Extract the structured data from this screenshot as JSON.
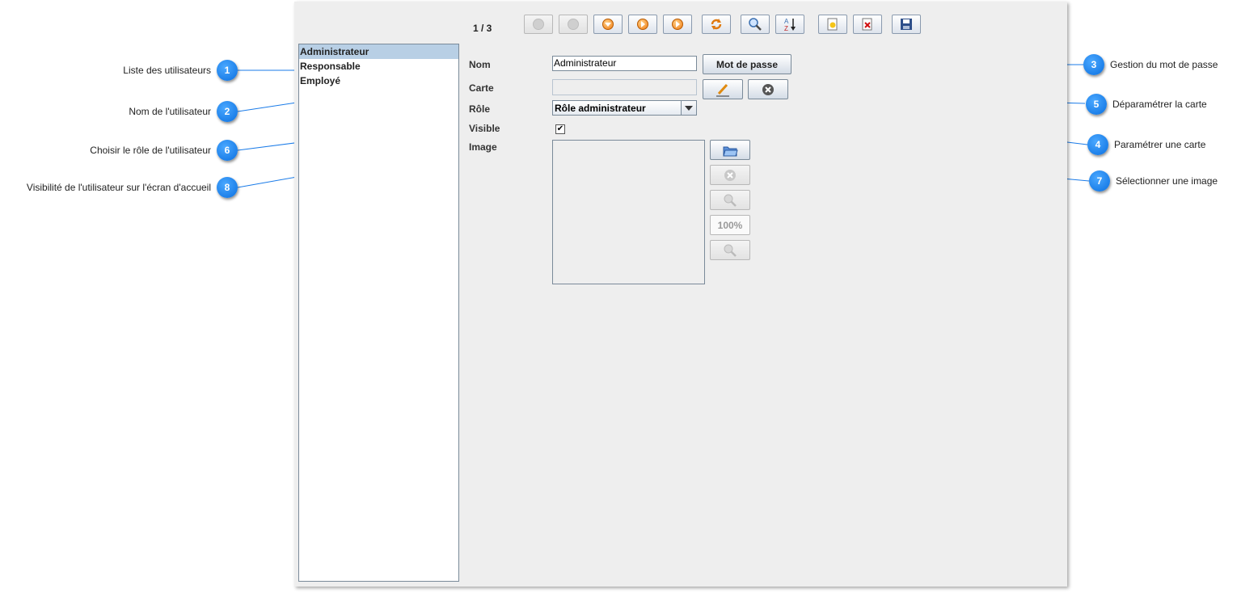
{
  "toolbar": {
    "counter": "1 / 3",
    "zoom_label": "100%"
  },
  "users": [
    "Administrateur",
    "Responsable",
    "Employé"
  ],
  "form": {
    "nom_label": "Nom",
    "nom_value": "Administrateur",
    "carte_label": "Carte",
    "carte_value": "",
    "role_label": "Rôle",
    "role_value": "Rôle administrateur",
    "visible_label": "Visible",
    "image_label": "Image",
    "password_button": "Mot de passe"
  },
  "annotations": [
    {
      "num": "1",
      "text": "Liste des utilisateurs"
    },
    {
      "num": "2",
      "text": "Nom de l'utilisateur"
    },
    {
      "num": "3",
      "text": "Gestion du mot de passe"
    },
    {
      "num": "4",
      "text": "Paramétrer une carte"
    },
    {
      "num": "5",
      "text": "Déparamétrer la carte"
    },
    {
      "num": "6",
      "text": "Choisir le rôle de l'utilisateur"
    },
    {
      "num": "7",
      "text": "Sélectionner une image"
    },
    {
      "num": "8",
      "text": "Visibilité de l'utilisateur sur l'écran d'accueil"
    }
  ],
  "colors": {
    "accent": "#0a6fe0",
    "selection": "#b8cfe5",
    "panel": "#eeeeee"
  }
}
